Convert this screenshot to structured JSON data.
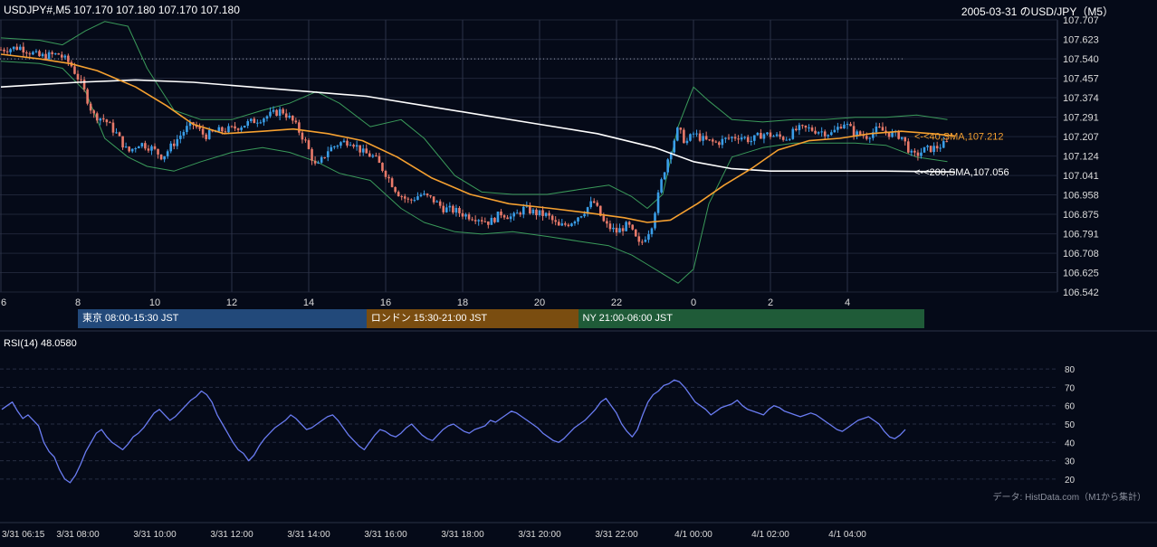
{
  "header": {
    "symbol_line": "USDJPY#,M5 107.170 107.180 107.170 107.180",
    "title": "2005-03-31 のUSD/JPY（M5）"
  },
  "indicators": {
    "sma40_label": "<-<40,SMA,107.212",
    "sma200_label": "<-<200,SMA,107.056",
    "rsi_label": "RSI(14) 48.0580"
  },
  "sessions": [
    {
      "label": "東京 08:00-15:30 JST",
      "color": "#22497a",
      "start_hour": 8.0,
      "end_hour": 15.5
    },
    {
      "label": "ロンドン 15:30-21:00 JST",
      "color": "#7a4d10",
      "start_hour": 15.5,
      "end_hour": 21.0
    },
    {
      "label": "NY 21:00-06:00 JST",
      "color": "#1f5b38",
      "start_hour": 21.0,
      "end_hour": 30.0
    }
  ],
  "source_note": "データ: HistData.com（M1から集計）",
  "colors": {
    "background": "#050a18",
    "up_candle": "#3a9ee8",
    "down_candle": "#e87a6a",
    "sma40": "#f5a030",
    "sma200": "#ffffff",
    "bollinger": "#3a9a5a",
    "rsi": "#6a7cf2",
    "grid": "#1f2538"
  },
  "chart_data": [
    {
      "type": "candlestick",
      "title": "2005-03-31 のUSD/JPY（M5）",
      "x_range_hours": [
        6.0,
        31.7
      ],
      "ylim": [
        106.542,
        107.707
      ],
      "y_ticks": [
        "107.707",
        "107.623",
        "107.540",
        "107.457",
        "107.374",
        "107.291",
        "107.207",
        "107.124",
        "107.041",
        "106.958",
        "106.875",
        "106.791",
        "106.708",
        "106.625",
        "106.542"
      ],
      "x_ticks": [
        {
          "hour": 6,
          "label": "6"
        },
        {
          "hour": 8,
          "label": "8"
        },
        {
          "hour": 10,
          "label": "10"
        },
        {
          "hour": 12,
          "label": "12"
        },
        {
          "hour": 14,
          "label": "14"
        },
        {
          "hour": 16,
          "label": "16"
        },
        {
          "hour": 18,
          "label": "18"
        },
        {
          "hour": 20,
          "label": "20"
        },
        {
          "hour": 22,
          "label": "22"
        },
        {
          "hour": 24,
          "label": "0"
        },
        {
          "hour": 26,
          "label": "2"
        },
        {
          "hour": 28,
          "label": "4"
        }
      ],
      "reference_line": 107.54,
      "close_path": [
        [
          6.0,
          107.58
        ],
        [
          6.5,
          107.59
        ],
        [
          7.0,
          107.55
        ],
        [
          7.5,
          107.56
        ],
        [
          7.8,
          107.52
        ],
        [
          8.1,
          107.43
        ],
        [
          8.4,
          107.3
        ],
        [
          8.7,
          107.28
        ],
        [
          9.0,
          107.22
        ],
        [
          9.3,
          107.14
        ],
        [
          9.6,
          107.18
        ],
        [
          9.9,
          107.16
        ],
        [
          10.2,
          107.12
        ],
        [
          10.5,
          107.18
        ],
        [
          10.8,
          107.24
        ],
        [
          11.0,
          107.26
        ],
        [
          11.3,
          107.21
        ],
        [
          11.6,
          107.23
        ],
        [
          12.0,
          107.24
        ],
        [
          12.5,
          107.27
        ],
        [
          13.0,
          107.3
        ],
        [
          13.3,
          107.32
        ],
        [
          13.6,
          107.27
        ],
        [
          13.9,
          107.19
        ],
        [
          14.2,
          107.07
        ],
        [
          14.5,
          107.15
        ],
        [
          14.8,
          107.18
        ],
        [
          15.1,
          107.19
        ],
        [
          15.4,
          107.14
        ],
        [
          15.7,
          107.12
        ],
        [
          16.0,
          107.05
        ],
        [
          16.3,
          106.97
        ],
        [
          16.6,
          106.93
        ],
        [
          16.9,
          106.96
        ],
        [
          17.2,
          106.94
        ],
        [
          17.5,
          106.9
        ],
        [
          17.8,
          106.89
        ],
        [
          18.1,
          106.87
        ],
        [
          18.4,
          106.86
        ],
        [
          18.7,
          106.84
        ],
        [
          19.0,
          106.88
        ],
        [
          19.3,
          106.86
        ],
        [
          19.6,
          106.9
        ],
        [
          19.9,
          106.88
        ],
        [
          20.2,
          106.87
        ],
        [
          20.5,
          106.82
        ],
        [
          20.8,
          106.84
        ],
        [
          21.1,
          106.88
        ],
        [
          21.4,
          106.93
        ],
        [
          21.7,
          106.83
        ],
        [
          22.0,
          106.8
        ],
        [
          22.3,
          106.83
        ],
        [
          22.6,
          106.74
        ],
        [
          22.9,
          106.82
        ],
        [
          23.2,
          107.04
        ],
        [
          23.4,
          107.15
        ],
        [
          23.6,
          107.24
        ],
        [
          23.8,
          107.18
        ],
        [
          24.0,
          107.22
        ],
        [
          24.3,
          107.19
        ],
        [
          24.6,
          107.18
        ],
        [
          24.9,
          107.2
        ],
        [
          25.2,
          107.21
        ],
        [
          25.5,
          107.19
        ],
        [
          25.8,
          107.22
        ],
        [
          26.1,
          107.21
        ],
        [
          26.4,
          107.2
        ],
        [
          26.7,
          107.24
        ],
        [
          27.0,
          107.24
        ],
        [
          27.3,
          107.23
        ],
        [
          27.6,
          107.22
        ],
        [
          27.9,
          107.27
        ],
        [
          28.2,
          107.22
        ],
        [
          28.5,
          107.21
        ],
        [
          28.8,
          107.24
        ],
        [
          29.1,
          107.22
        ],
        [
          29.4,
          107.21
        ],
        [
          29.7,
          107.12
        ],
        [
          30.0,
          107.15
        ],
        [
          30.3,
          107.16
        ],
        [
          30.6,
          107.18
        ]
      ],
      "sma40": [
        [
          6.0,
          107.56
        ],
        [
          7.0,
          107.54
        ],
        [
          7.8,
          107.52
        ],
        [
          8.5,
          107.49
        ],
        [
          9.5,
          107.42
        ],
        [
          10.3,
          107.34
        ],
        [
          11.0,
          107.26
        ],
        [
          11.8,
          107.22
        ],
        [
          12.8,
          107.23
        ],
        [
          13.6,
          107.24
        ],
        [
          14.5,
          107.22
        ],
        [
          15.4,
          107.19
        ],
        [
          16.3,
          107.12
        ],
        [
          17.2,
          107.03
        ],
        [
          18.2,
          106.96
        ],
        [
          19.2,
          106.92
        ],
        [
          20.3,
          106.9
        ],
        [
          21.3,
          106.88
        ],
        [
          22.2,
          106.86
        ],
        [
          22.8,
          106.84
        ],
        [
          23.4,
          106.85
        ],
        [
          24.1,
          106.92
        ],
        [
          24.8,
          107.0
        ],
        [
          25.5,
          107.07
        ],
        [
          26.2,
          107.15
        ],
        [
          27.0,
          107.19
        ],
        [
          27.8,
          107.2
        ],
        [
          28.6,
          107.22
        ],
        [
          29.4,
          107.23
        ],
        [
          30.2,
          107.22
        ],
        [
          30.8,
          107.21
        ]
      ],
      "sma200": [
        [
          6.0,
          107.42
        ],
        [
          7.0,
          107.43
        ],
        [
          8.0,
          107.44
        ],
        [
          9.5,
          107.45
        ],
        [
          11.0,
          107.44
        ],
        [
          12.5,
          107.42
        ],
        [
          14.0,
          107.4
        ],
        [
          15.5,
          107.38
        ],
        [
          17.0,
          107.34
        ],
        [
          18.5,
          107.3
        ],
        [
          20.0,
          107.26
        ],
        [
          21.5,
          107.22
        ],
        [
          23.0,
          107.16
        ],
        [
          24.0,
          107.1
        ],
        [
          25.0,
          107.07
        ],
        [
          26.0,
          107.06
        ],
        [
          27.0,
          107.06
        ],
        [
          28.0,
          107.06
        ],
        [
          29.0,
          107.06
        ],
        [
          30.0,
          107.058
        ],
        [
          30.8,
          107.056
        ]
      ],
      "bb_upper": [
        [
          6.0,
          107.63
        ],
        [
          7.0,
          107.62
        ],
        [
          7.6,
          107.6
        ],
        [
          8.2,
          107.66
        ],
        [
          8.7,
          107.7
        ],
        [
          9.3,
          107.68
        ],
        [
          9.8,
          107.5
        ],
        [
          10.5,
          107.32
        ],
        [
          11.2,
          107.28
        ],
        [
          12.0,
          107.28
        ],
        [
          12.8,
          107.32
        ],
        [
          13.5,
          107.35
        ],
        [
          14.2,
          107.4
        ],
        [
          14.8,
          107.35
        ],
        [
          15.6,
          107.25
        ],
        [
          16.4,
          107.28
        ],
        [
          17.0,
          107.2
        ],
        [
          17.8,
          107.04
        ],
        [
          18.5,
          106.97
        ],
        [
          19.3,
          106.96
        ],
        [
          20.2,
          106.96
        ],
        [
          21.0,
          106.98
        ],
        [
          21.8,
          107.0
        ],
        [
          22.4,
          106.95
        ],
        [
          22.8,
          106.9
        ],
        [
          23.2,
          106.96
        ],
        [
          23.6,
          107.25
        ],
        [
          24.0,
          107.42
        ],
        [
          24.4,
          107.36
        ],
        [
          25.0,
          107.28
        ],
        [
          25.8,
          107.27
        ],
        [
          26.6,
          107.28
        ],
        [
          27.4,
          107.28
        ],
        [
          28.2,
          107.29
        ],
        [
          29.0,
          107.29
        ],
        [
          29.8,
          107.3
        ],
        [
          30.6,
          107.28
        ]
      ],
      "bb_lower": [
        [
          6.0,
          107.53
        ],
        [
          7.0,
          107.52
        ],
        [
          7.6,
          107.5
        ],
        [
          8.2,
          107.4
        ],
        [
          8.7,
          107.2
        ],
        [
          9.3,
          107.12
        ],
        [
          9.8,
          107.08
        ],
        [
          10.5,
          107.06
        ],
        [
          11.2,
          107.1
        ],
        [
          12.0,
          107.14
        ],
        [
          12.8,
          107.16
        ],
        [
          13.5,
          107.14
        ],
        [
          14.2,
          107.1
        ],
        [
          14.8,
          107.05
        ],
        [
          15.6,
          107.02
        ],
        [
          16.4,
          106.9
        ],
        [
          17.0,
          106.84
        ],
        [
          17.8,
          106.8
        ],
        [
          18.5,
          106.79
        ],
        [
          19.3,
          106.8
        ],
        [
          20.2,
          106.78
        ],
        [
          21.0,
          106.76
        ],
        [
          21.8,
          106.74
        ],
        [
          22.4,
          106.7
        ],
        [
          22.8,
          106.66
        ],
        [
          23.2,
          106.62
        ],
        [
          23.6,
          106.58
        ],
        [
          24.0,
          106.64
        ],
        [
          24.4,
          106.92
        ],
        [
          25.0,
          107.12
        ],
        [
          25.8,
          107.16
        ],
        [
          26.6,
          107.18
        ],
        [
          27.4,
          107.18
        ],
        [
          28.2,
          107.18
        ],
        [
          29.0,
          107.17
        ],
        [
          29.8,
          107.12
        ],
        [
          30.6,
          107.1
        ]
      ]
    },
    {
      "type": "line",
      "title": "RSI(14) 48.0580",
      "ylim": [
        15,
        85
      ],
      "y_ticks": [
        80,
        70,
        60,
        50,
        40,
        30,
        20
      ],
      "x_ticks": [
        "3/31 06:15",
        "3/31 08:00",
        "3/31 10:00",
        "3/31 12:00",
        "3/31 14:00",
        "3/31 16:00",
        "3/31 18:00",
        "3/31 20:00",
        "3/31 22:00",
        "4/1 00:00",
        "4/1 02:00",
        "4/1 04:00"
      ],
      "series": [
        {
          "values": [
            58,
            60,
            62,
            57,
            53,
            55,
            52,
            49,
            40,
            35,
            32,
            25,
            20,
            18,
            22,
            28,
            35,
            40,
            45,
            47,
            43,
            40,
            38,
            36,
            39,
            43,
            45,
            48,
            52,
            56,
            58,
            55,
            52,
            54,
            57,
            60,
            63,
            65,
            68,
            66,
            62,
            55,
            50,
            45,
            40,
            36,
            34,
            30,
            33,
            38,
            42,
            45,
            48,
            50,
            52,
            55,
            53,
            50,
            47,
            48,
            50,
            52,
            54,
            55,
            52,
            48,
            44,
            41,
            38,
            36,
            40,
            44,
            47,
            46,
            44,
            43,
            45,
            48,
            50,
            47,
            44,
            42,
            41,
            44,
            47,
            49,
            50,
            48,
            46,
            45,
            47,
            48,
            49,
            52,
            51,
            53,
            55,
            57,
            56,
            54,
            52,
            50,
            48,
            45,
            43,
            41,
            40,
            42,
            45,
            48,
            50,
            52,
            55,
            58,
            62,
            64,
            60,
            56,
            50,
            46,
            43,
            47,
            55,
            62,
            66,
            68,
            71,
            72,
            74,
            73,
            70,
            66,
            62,
            60,
            58,
            55,
            57,
            59,
            60,
            61,
            63,
            60,
            58,
            57,
            56,
            55,
            58,
            60,
            59,
            57,
            56,
            55,
            54,
            55,
            56,
            55,
            53,
            51,
            49,
            47,
            46,
            48,
            50,
            52,
            53,
            54,
            52,
            50,
            46,
            43,
            42,
            44,
            47
          ]
        }
      ]
    }
  ]
}
